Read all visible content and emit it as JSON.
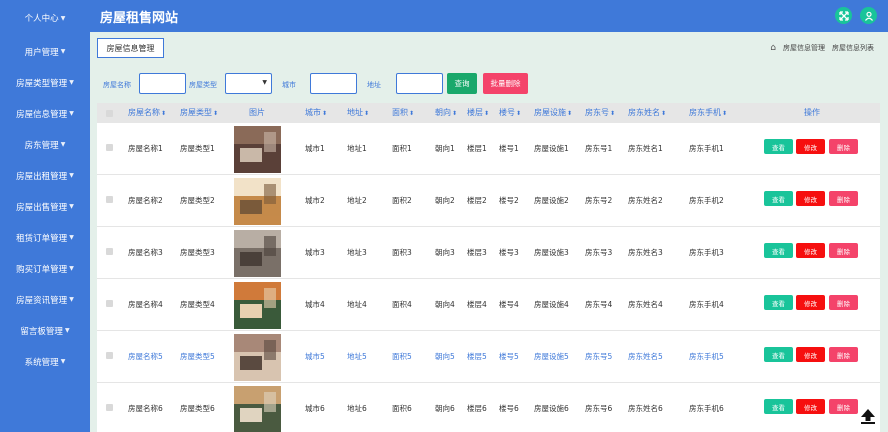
{
  "sidebar": {
    "items": [
      {
        "label": "个人中心"
      },
      {
        "label": "用户管理"
      },
      {
        "label": "房屋类型管理"
      },
      {
        "label": "房屋信息管理"
      },
      {
        "label": "房东管理"
      },
      {
        "label": "房屋出租管理"
      },
      {
        "label": "房屋出售管理"
      },
      {
        "label": "租赁订单管理"
      },
      {
        "label": "购买订单管理"
      },
      {
        "label": "房屋资讯管理"
      },
      {
        "label": "留言板管理"
      },
      {
        "label": "系统管理"
      }
    ]
  },
  "header": {
    "title": "房屋租售网站"
  },
  "page": {
    "tab_label": "房屋信息管理",
    "breadcrumb": [
      "房屋信息管理",
      "房屋信息列表"
    ]
  },
  "search": {
    "name_label": "房屋名称",
    "type_label": "房屋类型",
    "city_label": "城市",
    "address_label": "地址",
    "search_button": "查询",
    "bulk_delete_button": "批量删除"
  },
  "table": {
    "headers": {
      "name": "房屋名称",
      "type": "房屋类型",
      "image": "图片",
      "city": "城市",
      "address": "地址",
      "area": "面积",
      "orientation": "朝向",
      "floor": "楼层",
      "building": "楼号",
      "facilities": "房屋设施",
      "landlord_no": "房东号",
      "landlord_name": "房东姓名",
      "landlord_phone": "房东手机",
      "actions": "操作"
    },
    "actions": {
      "view": "查看",
      "edit": "修改",
      "delete": "删除"
    },
    "rows": [
      {
        "name": "房屋名称1",
        "type": "房屋类型1",
        "city": "城市1",
        "address": "地址1",
        "area": "面积1",
        "orientation": "朝向1",
        "floor": "楼层1",
        "building": "楼号1",
        "facilities": "房屋设施1",
        "landlord_no": "房东号1",
        "landlord_name": "房东姓名1",
        "landlord_phone": "房东手机1"
      },
      {
        "name": "房屋名称2",
        "type": "房屋类型2",
        "city": "城市2",
        "address": "地址2",
        "area": "面积2",
        "orientation": "朝向2",
        "floor": "楼层2",
        "building": "楼号2",
        "facilities": "房屋设施2",
        "landlord_no": "房东号2",
        "landlord_name": "房东姓名2",
        "landlord_phone": "房东手机2"
      },
      {
        "name": "房屋名称3",
        "type": "房屋类型3",
        "city": "城市3",
        "address": "地址3",
        "area": "面积3",
        "orientation": "朝向3",
        "floor": "楼层3",
        "building": "楼号3",
        "facilities": "房屋设施3",
        "landlord_no": "房东号3",
        "landlord_name": "房东姓名3",
        "landlord_phone": "房东手机3"
      },
      {
        "name": "房屋名称4",
        "type": "房屋类型4",
        "city": "城市4",
        "address": "地址4",
        "area": "面积4",
        "orientation": "朝向4",
        "floor": "楼层4",
        "building": "楼号4",
        "facilities": "房屋设施4",
        "landlord_no": "房东号4",
        "landlord_name": "房东姓名4",
        "landlord_phone": "房东手机4"
      },
      {
        "name": "房屋名称5",
        "type": "房屋类型5",
        "city": "城市5",
        "address": "地址5",
        "area": "面积5",
        "orientation": "朝向5",
        "floor": "楼层5",
        "building": "楼号5",
        "facilities": "房屋设施5",
        "landlord_no": "房东号5",
        "landlord_name": "房东姓名5",
        "landlord_phone": "房东手机5"
      },
      {
        "name": "房屋名称6",
        "type": "房屋类型6",
        "city": "城市6",
        "address": "地址6",
        "area": "面积6",
        "orientation": "朝向6",
        "floor": "楼层6",
        "building": "楼号6",
        "facilities": "房屋设施6",
        "landlord_no": "房东号6",
        "landlord_name": "房东姓名6",
        "landlord_phone": "房东手机6"
      }
    ]
  },
  "colors": {
    "primary": "#3f79d9",
    "success": "#19c49a",
    "danger": "#f60f0f",
    "pink": "#f4436a",
    "background": "#e4f0ea"
  }
}
